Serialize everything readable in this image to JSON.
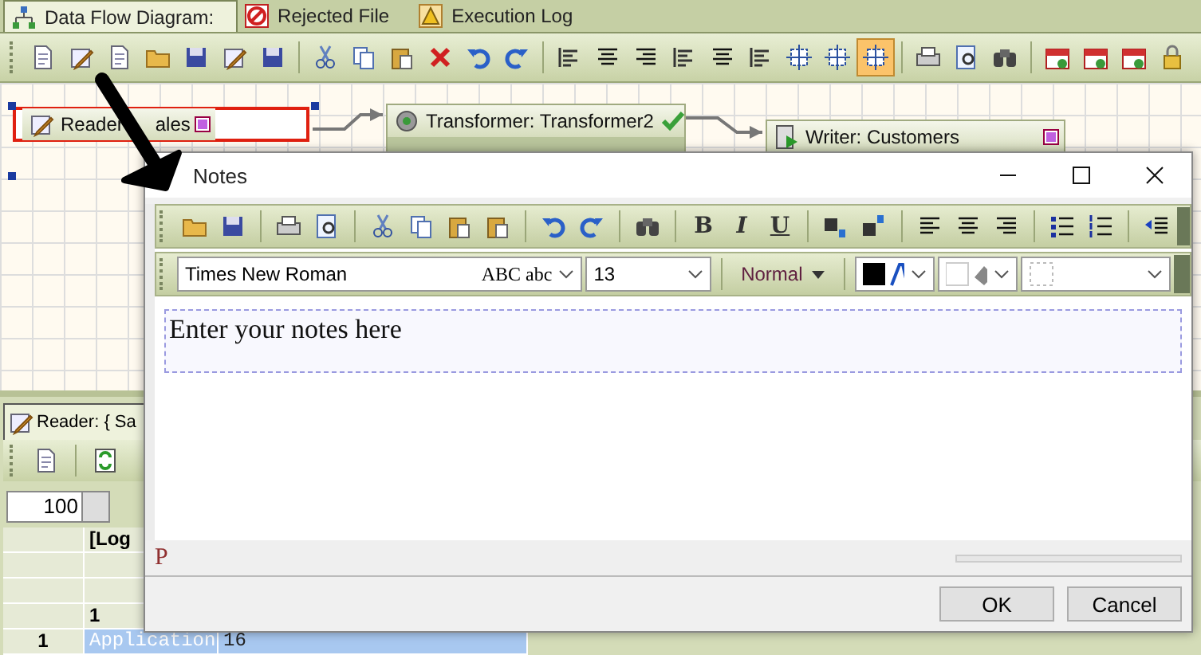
{
  "tabs": [
    {
      "label": "Data Flow Diagram:",
      "selected": true
    },
    {
      "label": "Rejected File",
      "selected": false
    },
    {
      "label": "Execution Log",
      "selected": false
    }
  ],
  "main_toolbar": [
    {
      "selected": false
    },
    {
      "selected": false
    },
    {
      "selected": false
    },
    {
      "selected": false
    },
    {
      "selected": false
    },
    {
      "selected": false
    },
    {
      "selected": false
    },
    {
      "selected": false
    },
    {
      "selected": false
    },
    {
      "selected": false
    },
    {
      "selected": false
    },
    {
      "selected": false
    },
    {
      "selected": false
    },
    {
      "selected": false
    },
    {
      "selected": false
    },
    {
      "selected": false
    },
    {
      "selected": false
    },
    {
      "selected": false
    },
    {
      "selected": false
    },
    {
      "selected": false
    },
    {
      "selected": false
    },
    {
      "selected": true
    },
    {
      "selected": false
    },
    {
      "selected": false
    },
    {
      "selected": false
    },
    {
      "selected": false
    },
    {
      "selected": false
    },
    {
      "selected": false
    },
    {
      "selected": false
    }
  ],
  "diagram": {
    "nodes": [
      {
        "kind": "reader",
        "title": "Reader",
        "title_end": "ales",
        "selected": true,
        "validated": false
      },
      {
        "kind": "transformer",
        "title": "Transformer: Transformer2",
        "selected": false,
        "validated": true
      },
      {
        "kind": "writer",
        "title": "Writer: Customers",
        "selected": false,
        "validated": false
      }
    ]
  },
  "bottom_panel": {
    "tab": "Reader: { Sa",
    "row_limit": "100",
    "header": {
      "column_1": "[Log"
    },
    "rows": [
      {},
      {},
      {
        "column_1": "1"
      },
      {
        "row_header": "1",
        "column_1": "Application",
        "column_2": "16"
      }
    ]
  },
  "notes_dialog": {
    "title": "Notes",
    "format_buttons": [
      "B",
      "I",
      "U"
    ],
    "font": "Times New Roman",
    "font_preview": "ABC abc",
    "size": "13",
    "paragraph_style": "Normal",
    "text": "Enter your notes here",
    "status": "P",
    "buttons": [
      "OK",
      "Cancel"
    ]
  }
}
